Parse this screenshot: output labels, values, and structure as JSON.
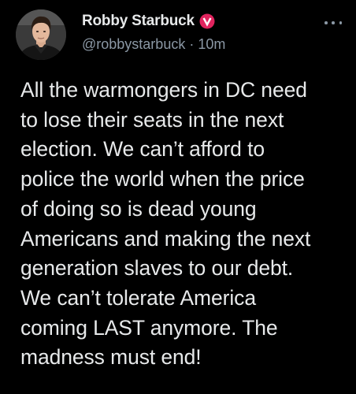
{
  "tweet": {
    "author": {
      "display_name": "Robby Starbuck",
      "handle": "@robbystarbuck",
      "avatar_icon": "profile-photo",
      "verified_badge_icon": "verified-badge-icon",
      "verified_badge_color": "#e0245e"
    },
    "separator": "·",
    "timestamp": "10m",
    "more_icon": "more-options-icon",
    "text_lines": [
      "All the warmongers in DC need",
      "to lose their seats in the next",
      "election. We can’t afford to",
      "police the world when the price",
      "of doing so is dead young",
      "Americans and making the next",
      "generation slaves to our debt.",
      "We can’t tolerate America",
      "coming LAST anymore. The",
      "madness must end!"
    ]
  },
  "colors": {
    "background": "#000000",
    "primary_text": "#e7e9ea",
    "secondary_text": "#8b98a5"
  }
}
